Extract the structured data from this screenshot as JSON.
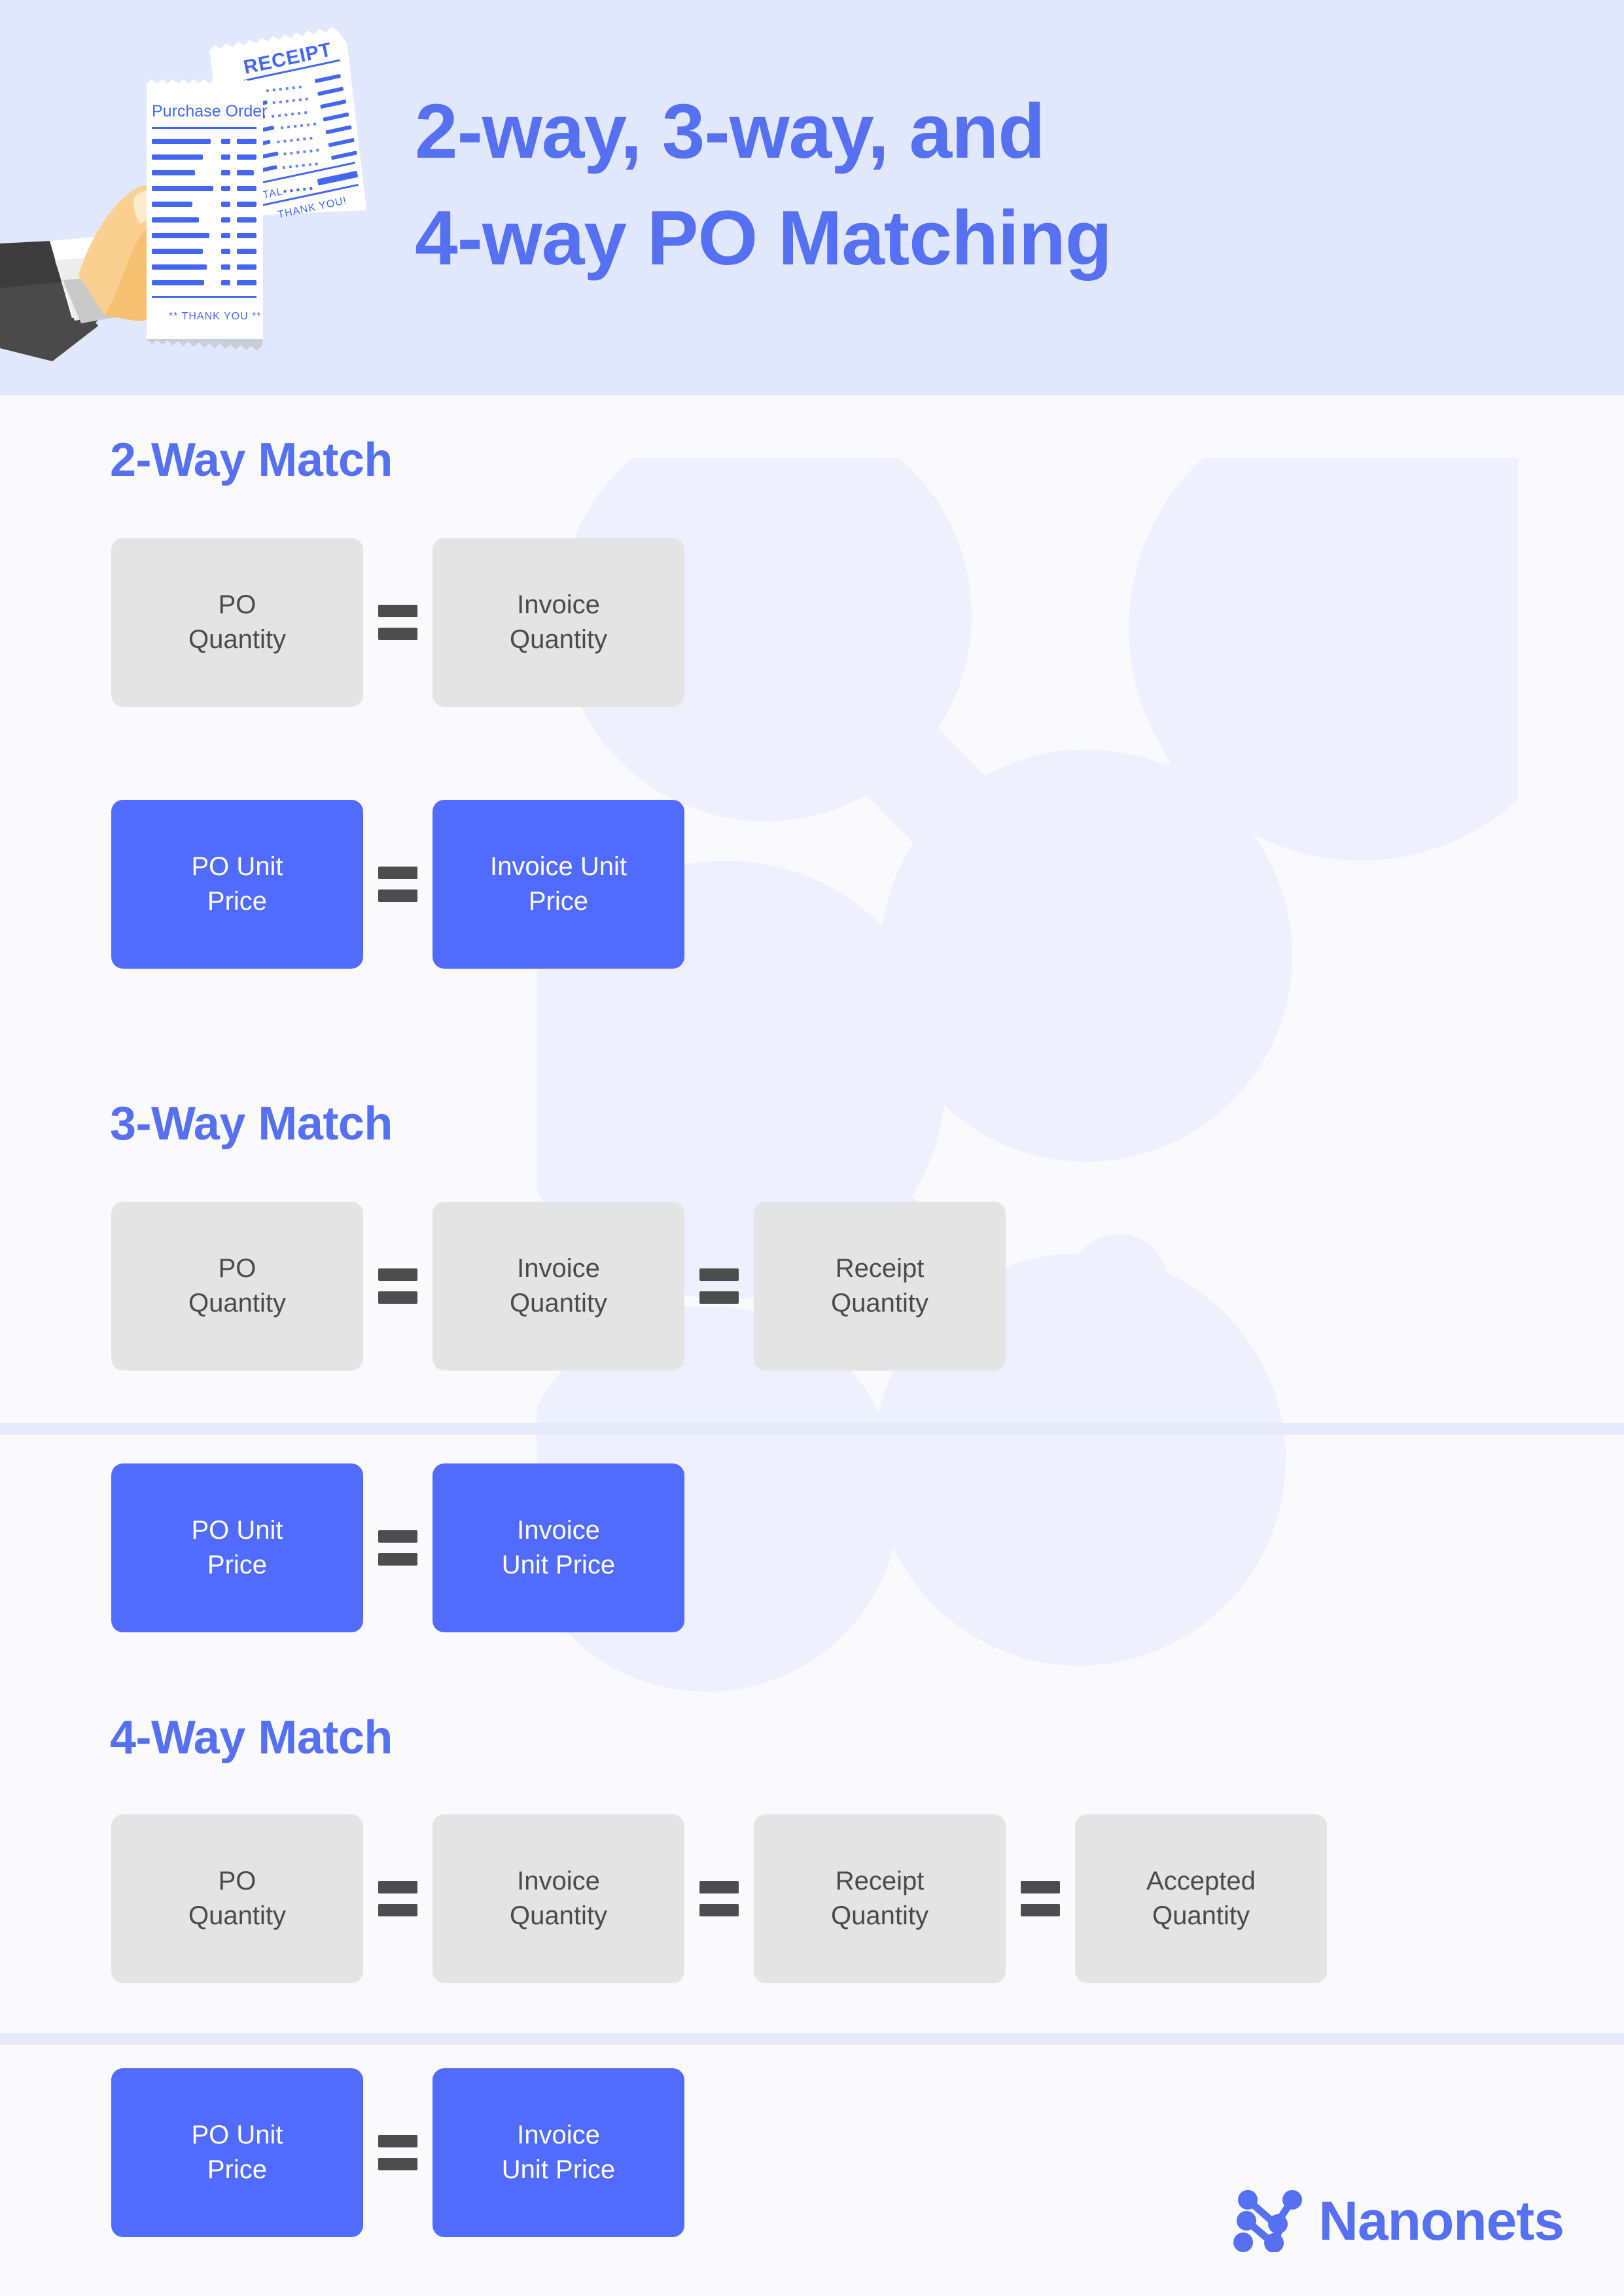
{
  "theme": {
    "header_bg": "#E2E8FC",
    "page_bg": "#FAFAFC",
    "accent_blue": "#5570F1",
    "chip_blue": "#516BFF",
    "chip_gray": "#E4E4E4",
    "gray_text": "#4A4A4A",
    "equals_color": "#4D4D4D",
    "divider": "#E4EAFB"
  },
  "header": {
    "title_line1": "2-way, 3-way, and",
    "title_line2": "4-way PO Matching",
    "illustration": {
      "name": "hand-holding-purchase-order-and-receipt",
      "purchase_order_label": "Purchase Order",
      "purchase_order_footer": "** THANK YOU **",
      "receipt_label": "RECEIPT",
      "receipt_total_label": "TOTAL",
      "receipt_footer": "THANK YOU!"
    }
  },
  "sections": [
    {
      "id": "2way",
      "title": "2-Way Match",
      "rows": [
        {
          "style": "gray",
          "chips": [
            "PO\nQuantity",
            "Invoice\nQuantity"
          ],
          "chip_lines": [
            [
              "PO",
              "Quantity"
            ],
            [
              "Invoice",
              "Quantity"
            ]
          ],
          "operators": [
            "="
          ]
        },
        {
          "style": "blue",
          "chips": [
            "PO Unit\nPrice",
            "Invoice Unit\nPrice"
          ],
          "chip_lines": [
            [
              "PO Unit",
              "Price"
            ],
            [
              "Invoice Unit",
              "Price"
            ]
          ],
          "operators": [
            "="
          ]
        }
      ]
    },
    {
      "id": "3way",
      "title": "3-Way Match",
      "rows": [
        {
          "style": "gray",
          "chips": [
            "PO\nQuantity",
            "Invoice\nQuantity",
            "Receipt\nQuantity"
          ],
          "chip_lines": [
            [
              "PO",
              "Quantity"
            ],
            [
              "Invoice",
              "Quantity"
            ],
            [
              "Receipt",
              "Quantity"
            ]
          ],
          "operators": [
            "=",
            "="
          ]
        },
        {
          "style": "blue",
          "chips": [
            "PO Unit\nPrice",
            "Invoice\nUnit Price"
          ],
          "chip_lines": [
            [
              "PO Unit",
              "Price"
            ],
            [
              "Invoice",
              "Unit Price"
            ]
          ],
          "operators": [
            "="
          ]
        }
      ]
    },
    {
      "id": "4way",
      "title": "4-Way Match",
      "rows": [
        {
          "style": "gray",
          "chips": [
            "PO\nQuantity",
            "Invoice\nQuantity",
            "Receipt\nQuantity",
            "Accepted\nQuantity"
          ],
          "chip_lines": [
            [
              "PO",
              "Quantity"
            ],
            [
              "Invoice",
              "Quantity"
            ],
            [
              "Receipt",
              "Quantity"
            ],
            [
              "Accepted",
              "Quantity"
            ]
          ],
          "operators": [
            "=",
            "=",
            "="
          ]
        },
        {
          "style": "blue",
          "chips": [
            "PO Unit\nPrice",
            "Invoice\nUnit Price"
          ],
          "chip_lines": [
            [
              "PO Unit",
              "Price"
            ],
            [
              "Invoice",
              "Unit Price"
            ]
          ],
          "operators": [
            "="
          ]
        }
      ]
    }
  ],
  "footer": {
    "brand": "Nanonets",
    "logo_icon": "nanonets-network-logo"
  }
}
